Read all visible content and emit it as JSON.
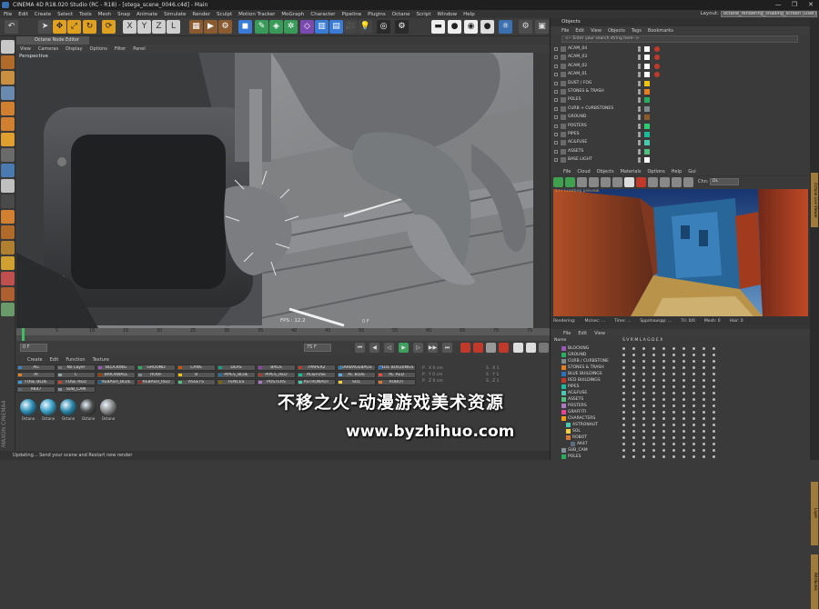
{
  "window": {
    "title": "CINEMA 4D R18.020 Studio (RC - R18) - [otega_scene_0046.c4d] - Main",
    "controls": [
      "—",
      "❐",
      "✕"
    ]
  },
  "menubar": [
    "File",
    "Edit",
    "Create",
    "Select",
    "Tools",
    "Mesh",
    "Snap",
    "Animate",
    "Simulate",
    "Render",
    "Sculpt",
    "Motion Tracker",
    "MoGraph",
    "Character",
    "Pipeline",
    "Plugins",
    "Octane",
    "Script",
    "Window",
    "Help"
  ],
  "layout": {
    "label": "Layout:",
    "value": "octane_rendering_shading_screen (User)"
  },
  "viewport": {
    "tab_label": "Octane Node Editor [edit]",
    "menu": [
      "View",
      "Cameras",
      "Display",
      "Options",
      "Filter",
      "Panel"
    ],
    "label": "Perspective",
    "fps": "FPS : 12.2",
    "frame": "0 F"
  },
  "timeline": {
    "ticks": [
      "0",
      "5",
      "10",
      "15",
      "20",
      "25",
      "30",
      "35",
      "40",
      "45",
      "50",
      "55",
      "60",
      "65",
      "70",
      "75"
    ],
    "start": "0 F",
    "end": "75 F"
  },
  "transport": [
    "⏮",
    "◀",
    "◁",
    "▶",
    "▷",
    "▶▶",
    "⏭"
  ],
  "material_menu": [
    "Create",
    "Edit",
    "Function",
    "Texture"
  ],
  "layers": [
    {
      "label": "AG",
      "color": "#3b82c4"
    },
    {
      "label": "No Layer",
      "color": "#777777"
    },
    {
      "label": "BLOCKING",
      "color": "#9b59b6"
    },
    {
      "label": "GROUND",
      "color": "#27ae60"
    },
    {
      "label": "CANS",
      "color": "#d35400"
    },
    {
      "label": "DEAS",
      "color": "#16a085"
    },
    {
      "label": "BAGS",
      "color": "#8e44ad"
    },
    {
      "label": "7PAPER2",
      "color": "#c0392b"
    },
    {
      "label": "GARBAGEBAGS",
      "color": "#2980b9"
    },
    {
      "label": "BLUE BUILDINGS",
      "color": "#2c6fbb"
    },
    {
      "label": "AI",
      "color": "#e67e22"
    },
    {
      "label": "C",
      "color": "#95a5a6"
    },
    {
      "label": "BRICKWALL",
      "color": "#a04000"
    },
    {
      "label": "ROOF",
      "color": "#7f8c8d"
    },
    {
      "label": "8",
      "color": "#f1c40f"
    },
    {
      "label": "PIPES_BLUE",
      "color": "#2471a3"
    },
    {
      "label": "PIPES_RED",
      "color": "#b03a2e"
    },
    {
      "label": "AC&FUSE",
      "color": "#1abc9c"
    },
    {
      "label": "AC BLUE",
      "color": "#5dade2"
    },
    {
      "label": "AC RED",
      "color": "#e74c3c"
    },
    {
      "label": "FUSE BLUE",
      "color": "#3498db"
    },
    {
      "label": "FUSE RED",
      "color": "#cb4335"
    },
    {
      "label": "REBASH_BLUE",
      "color": "#21618c"
    },
    {
      "label": "REBASH_RED",
      "color": "#922b21"
    },
    {
      "label": "ASSETS",
      "color": "#52be80"
    },
    {
      "label": "FENCES",
      "color": "#7d6608"
    },
    {
      "label": "POSTERS",
      "color": "#af7ac5"
    },
    {
      "label": "ASTRONAUT",
      "color": "#48c9b0"
    },
    {
      "label": "SOL",
      "color": "#f4d03f"
    },
    {
      "label": "ROBOT",
      "color": "#dc7633"
    },
    {
      "label": "AK47",
      "color": "#5d6d7e"
    },
    {
      "label": "SUB_CAM",
      "color": "#85929e"
    }
  ],
  "materials": [
    {
      "label": "Octane",
      "color": "#2e8fb5"
    },
    {
      "label": "Octane",
      "color": "#3aa0c5"
    },
    {
      "label": "Octane",
      "color": "#2c86aa"
    },
    {
      "label": "Octane",
      "color": "#4a4a4a"
    },
    {
      "label": "Octane",
      "color": "#8a8a8a"
    }
  ],
  "status": "Updating...  Send your scene and Restart new render",
  "watermark": {
    "line1": "不移之火-动漫游戏美术资源",
    "line2": "www.byzhihuo.com"
  },
  "objects_panel": {
    "title": "Objects",
    "menu": [
      "File",
      "Edit",
      "View",
      "Objects",
      "Tags",
      "Bookmarks"
    ],
    "search_placeholder": "<-- Enter your search string here-->",
    "rows": [
      {
        "name": "ACAM_04",
        "color": "#ffffff",
        "tag": true
      },
      {
        "name": "ACAM_03",
        "color": "#ffffff",
        "tag": true
      },
      {
        "name": "ACAM_02",
        "color": "#ffffff",
        "tag": true
      },
      {
        "name": "ACAM_01",
        "color": "#ffffff",
        "tag": true
      },
      {
        "name": "DUST / FOG",
        "color": "#f1c40f",
        "tag": false
      },
      {
        "name": "STONES & TRASH",
        "color": "#e67e22",
        "tag": false
      },
      {
        "name": "POLES",
        "color": "#27ae60",
        "tag": false
      },
      {
        "name": "CURB + CURBSTONES",
        "color": "#7f8c8d",
        "tag": false
      },
      {
        "name": "GROUND",
        "color": "#8b5a2b",
        "tag": false
      },
      {
        "name": "POSTERS",
        "color": "#2ecc71",
        "tag": false
      },
      {
        "name": "PIPES",
        "color": "#1abc9c",
        "tag": false
      },
      {
        "name": "AC&FUSE",
        "color": "#48c9b0",
        "tag": false
      },
      {
        "name": "ASSETS",
        "color": "#52be80",
        "tag": false
      },
      {
        "name": "BASE LIGHT",
        "color": "#ffffff",
        "tag": false
      }
    ]
  },
  "render_panel": {
    "menu": [
      "File",
      "Cloud",
      "Objects",
      "Materials",
      "Options",
      "Help",
      "Gui"
    ],
    "channel_label": "Chn:",
    "channel_value": "DL",
    "warning": "177 Creating preview",
    "status": [
      "Rendering:",
      "Ms/sec: ...",
      "Time: ...",
      "Spp/maxspp: ...",
      "Tri: 0/0",
      "Mesh: 0",
      "Hair: 0"
    ]
  },
  "layer_panel": {
    "menu": [
      "File",
      "Edit",
      "View"
    ],
    "head_name": "Name",
    "head_flags": "S V R M L A G D E X",
    "rows": [
      {
        "name": "BLOCKING",
        "color": "#9b59b6",
        "indent": 0
      },
      {
        "name": "GROUND",
        "color": "#27ae60",
        "indent": 0
      },
      {
        "name": "CURB / CURBSTONE",
        "color": "#7f8c8d",
        "indent": 0
      },
      {
        "name": "STONES & TRASH",
        "color": "#e67e22",
        "indent": 0
      },
      {
        "name": "BLUE BUILDINGS",
        "color": "#2c6fbb",
        "indent": 0
      },
      {
        "name": "RED BUILDINGS",
        "color": "#c0392b",
        "indent": 0
      },
      {
        "name": "PIPES",
        "color": "#1abc9c",
        "indent": 0
      },
      {
        "name": "AC&FUSE",
        "color": "#48c9b0",
        "indent": 0
      },
      {
        "name": "ASSETS",
        "color": "#52be80",
        "indent": 0
      },
      {
        "name": "POSTERS",
        "color": "#af7ac5",
        "indent": 0
      },
      {
        "name": "GRAFFITI",
        "color": "#e84393",
        "indent": 0
      },
      {
        "name": "CHARACTERS",
        "color": "#f39c12",
        "indent": 0
      },
      {
        "name": "ASTRONAUT",
        "color": "#48c9b0",
        "indent": 1
      },
      {
        "name": "SOL",
        "color": "#f4d03f",
        "indent": 1
      },
      {
        "name": "ROBOT",
        "color": "#dc7633",
        "indent": 1
      },
      {
        "name": "AK47",
        "color": "#5d6d7e",
        "indent": 2
      },
      {
        "name": "SUB_CAM",
        "color": "#85929e",
        "indent": 0
      },
      {
        "name": "POLES",
        "color": "#27ae60",
        "indent": 0
      }
    ]
  },
  "attr_rows": [
    "P . X 0 cm",
    "P . Y 0 cm",
    "P . Z 0 cm",
    "S . X 1",
    "S . Y 1",
    "S . Z 1"
  ],
  "side_tabs": [
    "Octane Live Viewer",
    "Layer",
    "Attributes"
  ]
}
